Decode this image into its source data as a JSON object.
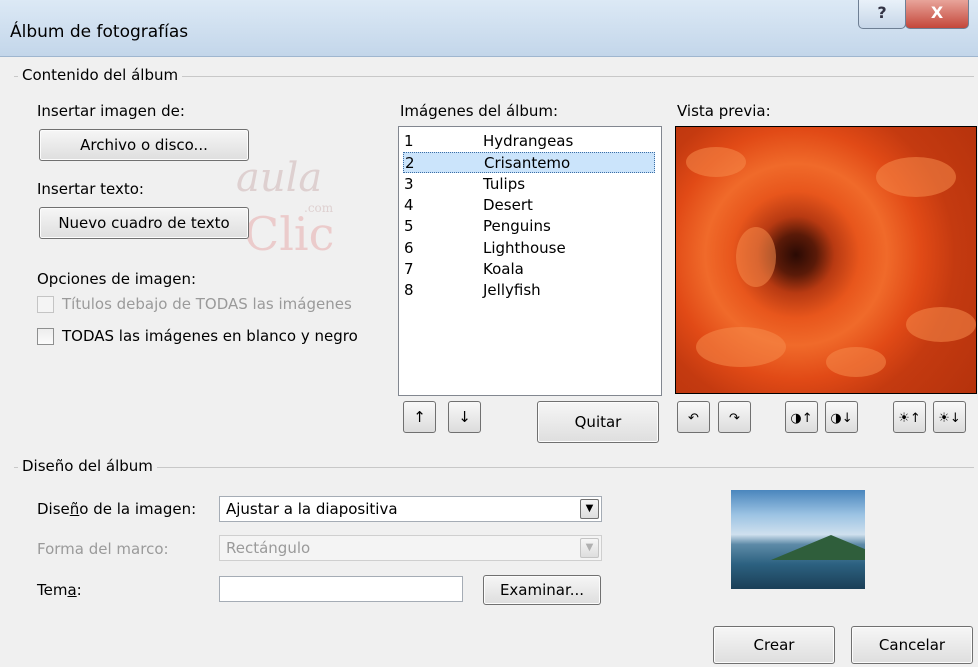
{
  "window": {
    "title": "Álbum de fotografías",
    "help_icon": "?",
    "close_icon": "X"
  },
  "content_group": {
    "legend": "Contenido del álbum",
    "insert_image_label": "Insertar imagen de:",
    "file_button": "Archivo o disco...",
    "insert_text_label": "Insertar texto:",
    "new_textbox_button": "Nuevo cuadro de texto",
    "image_options_label": "Opciones de imagen:",
    "option_captions": {
      "label": "Títulos debajo de TODAS las imágenes",
      "checked": false,
      "enabled": false
    },
    "option_bw": {
      "label": "TODAS las imágenes en blanco y negro",
      "checked": false,
      "enabled": true
    }
  },
  "album_list": {
    "label": "Imágenes del álbum:",
    "selected_index": 1,
    "items": [
      {
        "num": "1",
        "name": "Hydrangeas"
      },
      {
        "num": "2",
        "name": "Crisantemo"
      },
      {
        "num": "3",
        "name": "Tulips"
      },
      {
        "num": "4",
        "name": "Desert"
      },
      {
        "num": "5",
        "name": "Penguins"
      },
      {
        "num": "6",
        "name": "Lighthouse"
      },
      {
        "num": "7",
        "name": "Koala"
      },
      {
        "num": "8",
        "name": "Jellyfish"
      }
    ],
    "move_up_icon": "↑",
    "move_down_icon": "↓",
    "remove_button": "Quitar"
  },
  "preview": {
    "label": "Vista previa:",
    "tools": [
      {
        "name": "rotate-left-icon",
        "glyph": "↶"
      },
      {
        "name": "rotate-right-icon",
        "glyph": "↷"
      },
      {
        "name": "contrast-up-icon",
        "glyph": "◑↑"
      },
      {
        "name": "contrast-down-icon",
        "glyph": "◑↓"
      },
      {
        "name": "brightness-up-icon",
        "glyph": "☀↑"
      },
      {
        "name": "brightness-down-icon",
        "glyph": "☀↓"
      }
    ]
  },
  "layout_group": {
    "legend": "Diseño del álbum",
    "picture_layout_label": "Diseño de la imagen:",
    "picture_layout_value": "Ajustar a la diapositiva",
    "frame_shape_label": "Forma del marco:",
    "frame_shape_value": "Rectángulo",
    "theme_label": "Tema:",
    "theme_value": "",
    "browse_button": "Examinar...",
    "create_button": "Crear",
    "cancel_button": "Cancelar"
  },
  "watermark": {
    "line1": "aula",
    "line2": "Clic",
    "small": ".com"
  },
  "colors": {
    "selection": "#cbe4fb",
    "dialog_bg": "#f0f0f0",
    "close_red": "#c4473a"
  }
}
